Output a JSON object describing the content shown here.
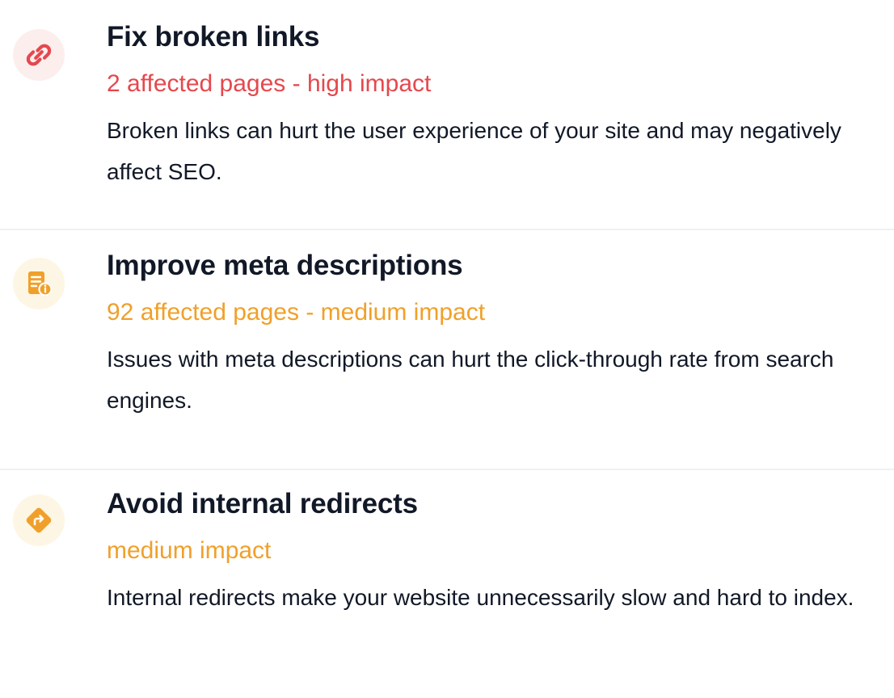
{
  "colors": {
    "high": "#e5484d",
    "medium": "#f0a02a",
    "high_bg": "#fdeeee",
    "medium_bg": "#fef6e4",
    "text": "#111827",
    "divider": "#eef0f2"
  },
  "issues": [
    {
      "icon": "link-icon",
      "title": "Fix broken links",
      "impact": "2 affected pages - high impact",
      "severity": "high",
      "description": "Broken links can hurt the user experience of your site and may negatively affect SEO."
    },
    {
      "icon": "document-info-icon",
      "title": "Improve meta descriptions",
      "impact": "92 affected pages - medium impact",
      "severity": "medium",
      "description": "Issues with meta descriptions can hurt the click-through rate from search engines."
    },
    {
      "icon": "redirect-icon",
      "title": "Avoid internal redirects",
      "impact": "medium impact",
      "severity": "medium",
      "description": "Internal redirects make your website unnecessarily slow and hard to index."
    }
  ]
}
